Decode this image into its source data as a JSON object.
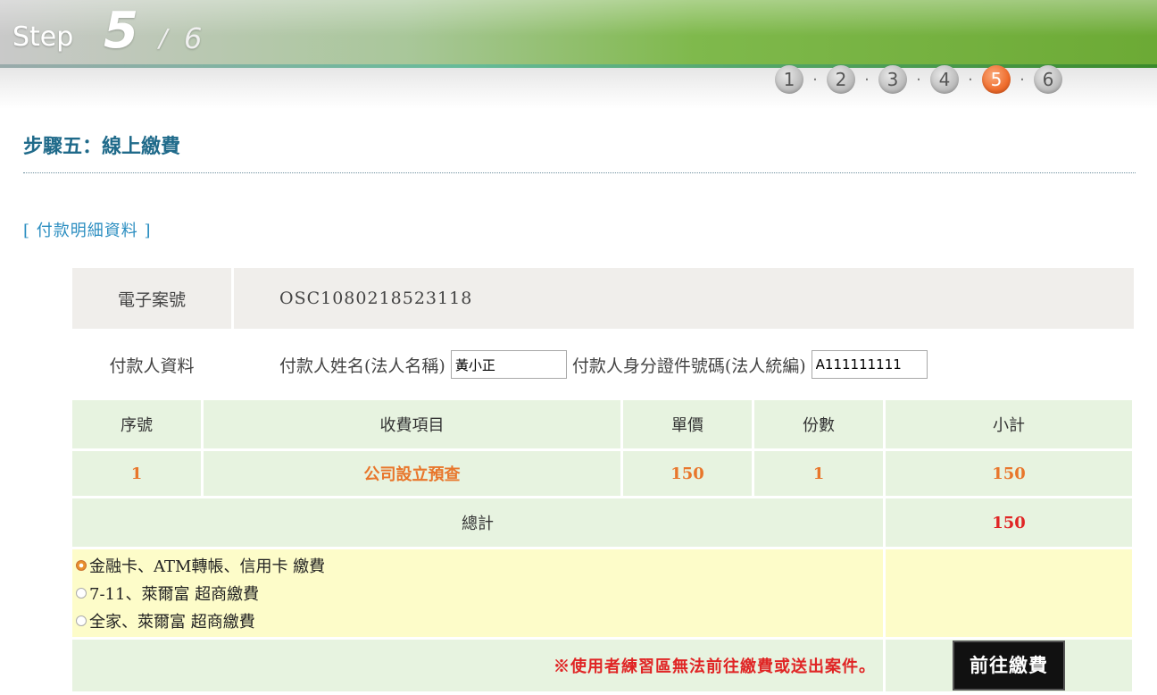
{
  "header": {
    "step_word": "Step",
    "current_step": "5",
    "slash": "/",
    "total_steps": "6",
    "steps": [
      "1",
      "2",
      "3",
      "4",
      "5",
      "6"
    ],
    "active_step": 5,
    "dot_separator": "·"
  },
  "page": {
    "title": "步驟五：線上繳費",
    "section_label": "[ 付款明細資料 ]"
  },
  "case": {
    "label": "電子案號",
    "value": "OSC1080218523118"
  },
  "payer": {
    "label": "付款人資料",
    "name_label": "付款人姓名(法人名稱)",
    "name_value": "黃小正",
    "id_label": "付款人身分證件號碼(法人統編)",
    "id_value": "A111111111"
  },
  "table": {
    "headers": [
      "序號",
      "收費項目",
      "單價",
      "份數",
      "小計"
    ],
    "rows": [
      [
        "1",
        "公司設立預查",
        "150",
        "1",
        "150"
      ]
    ],
    "total_label": "總計",
    "total_value": "150"
  },
  "payment_options": [
    {
      "label": "金融卡、ATM轉帳、信用卡 繳費",
      "checked": true
    },
    {
      "label": "7-11、萊爾富 超商繳費",
      "checked": false
    },
    {
      "label": "全家、萊爾富 超商繳費",
      "checked": false
    }
  ],
  "notice": "※使用者練習區無法前往繳費或送出案件。",
  "pay_button": "前往繳費",
  "colors": {
    "title": "#1f6a8a",
    "section": "#2a8dc0",
    "orange_value": "#e8762b",
    "red_total": "#e02525",
    "green_cell": "#e7f3e0",
    "yellow_cell": "#fdfcc9",
    "active_dot": "#ef6c2c"
  }
}
